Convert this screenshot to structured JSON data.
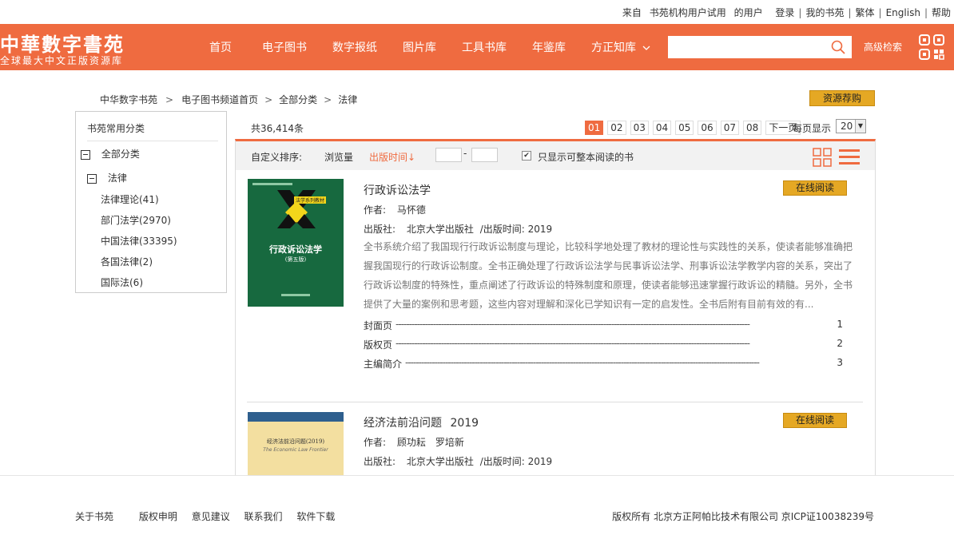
{
  "top_links": {
    "from": "来自",
    "org": "书苑机构用户试用",
    "user_suffix": "的用户",
    "login": "登录",
    "my_shelf": "我的书苑",
    "traditional": "繁体",
    "english": "English",
    "help": "帮助"
  },
  "header": {
    "logo_main": "中華數字書苑",
    "logo_sub": "全球最大中文正版资源库",
    "nav": [
      "首页",
      "电子图书",
      "数字报纸",
      "图片库",
      "工具书库",
      "年鉴库",
      "方正知库"
    ],
    "search_placeholder": "",
    "advanced_search": "高级检索",
    "brand_color": "#ef6b40"
  },
  "breadcrumb": [
    "中华数字书苑",
    "电子图书频道首页",
    "全部分类",
    "法律"
  ],
  "resource_button": "资源荐购",
  "sidebar": {
    "title": "书苑常用分类",
    "root": "全部分类",
    "category": "法律",
    "children": [
      "法律理论(41)",
      "部门法学(2970)",
      "中国法律(33395)",
      "各国法律(2)",
      "国际法(6)"
    ]
  },
  "results": {
    "total": "共36,414条",
    "pages": [
      "01",
      "02",
      "03",
      "04",
      "05",
      "06",
      "07",
      "08"
    ],
    "current_page": "01",
    "next": "下一页",
    "per_page_label": "每页显示",
    "per_page_value": "20"
  },
  "sortbar": {
    "label": "自定义排序:",
    "by_views": "浏览量",
    "by_date": "出版时间↓",
    "range_sep": "-",
    "only_full_label": "只显示可整本阅读的书",
    "only_full_checked": true
  },
  "books": [
    {
      "title": "行政诉讼法学",
      "author_label": "作者:",
      "authors": "马怀德",
      "publisher_label": "出版社:",
      "publisher": "北京大学出版社",
      "date_label": "/出版时间:",
      "year": "2019",
      "description": "全书系统介绍了我国现行行政诉讼制度与理论，比较科学地处理了教材的理论性与实践性的关系，使读者能够准确把握我国现行的行政诉讼制度。全书正确处理了行政诉讼法学与民事诉讼法学、刑事诉讼法学教学内容的关系，突出了行政诉讼制度的特殊性，重点阐述了行政诉讼的特殊制度和原理，使读者能够迅速掌握行政诉讼的精髓。另外，全书提供了大量的案例和思考题，这些内容对理解和深化已学知识有一定的启发性。全书后附有目前有效的有...",
      "read_button": "在线阅读",
      "cover_title": "行政诉讼法学",
      "cover_edition": "(第五版)",
      "cover_series": "法学系列教材",
      "toc": [
        {
          "name": "封面页",
          "page": "1"
        },
        {
          "name": "版权页",
          "page": "2"
        },
        {
          "name": "主编简介",
          "page": "3"
        }
      ]
    },
    {
      "title": "经济法前沿问题",
      "title_year": "2019",
      "author_label": "作者:",
      "authors": "顾功耘　罗培新",
      "publisher_label": "出版社:",
      "publisher": "北京大学出版社",
      "date_label": "/出版时间:",
      "year": "2019",
      "read_button": "在线阅读",
      "cover_title": "经济法前沿问题(2019)",
      "cover_subtitle": "The Economic Law Frontier"
    }
  ],
  "footer": {
    "links": [
      "关于书苑",
      "版权申明",
      "意见建议",
      "联系我们",
      "软件下载"
    ],
    "copyright": "版权所有  北京方正阿帕比技术有限公司  京ICP证10038239号"
  }
}
